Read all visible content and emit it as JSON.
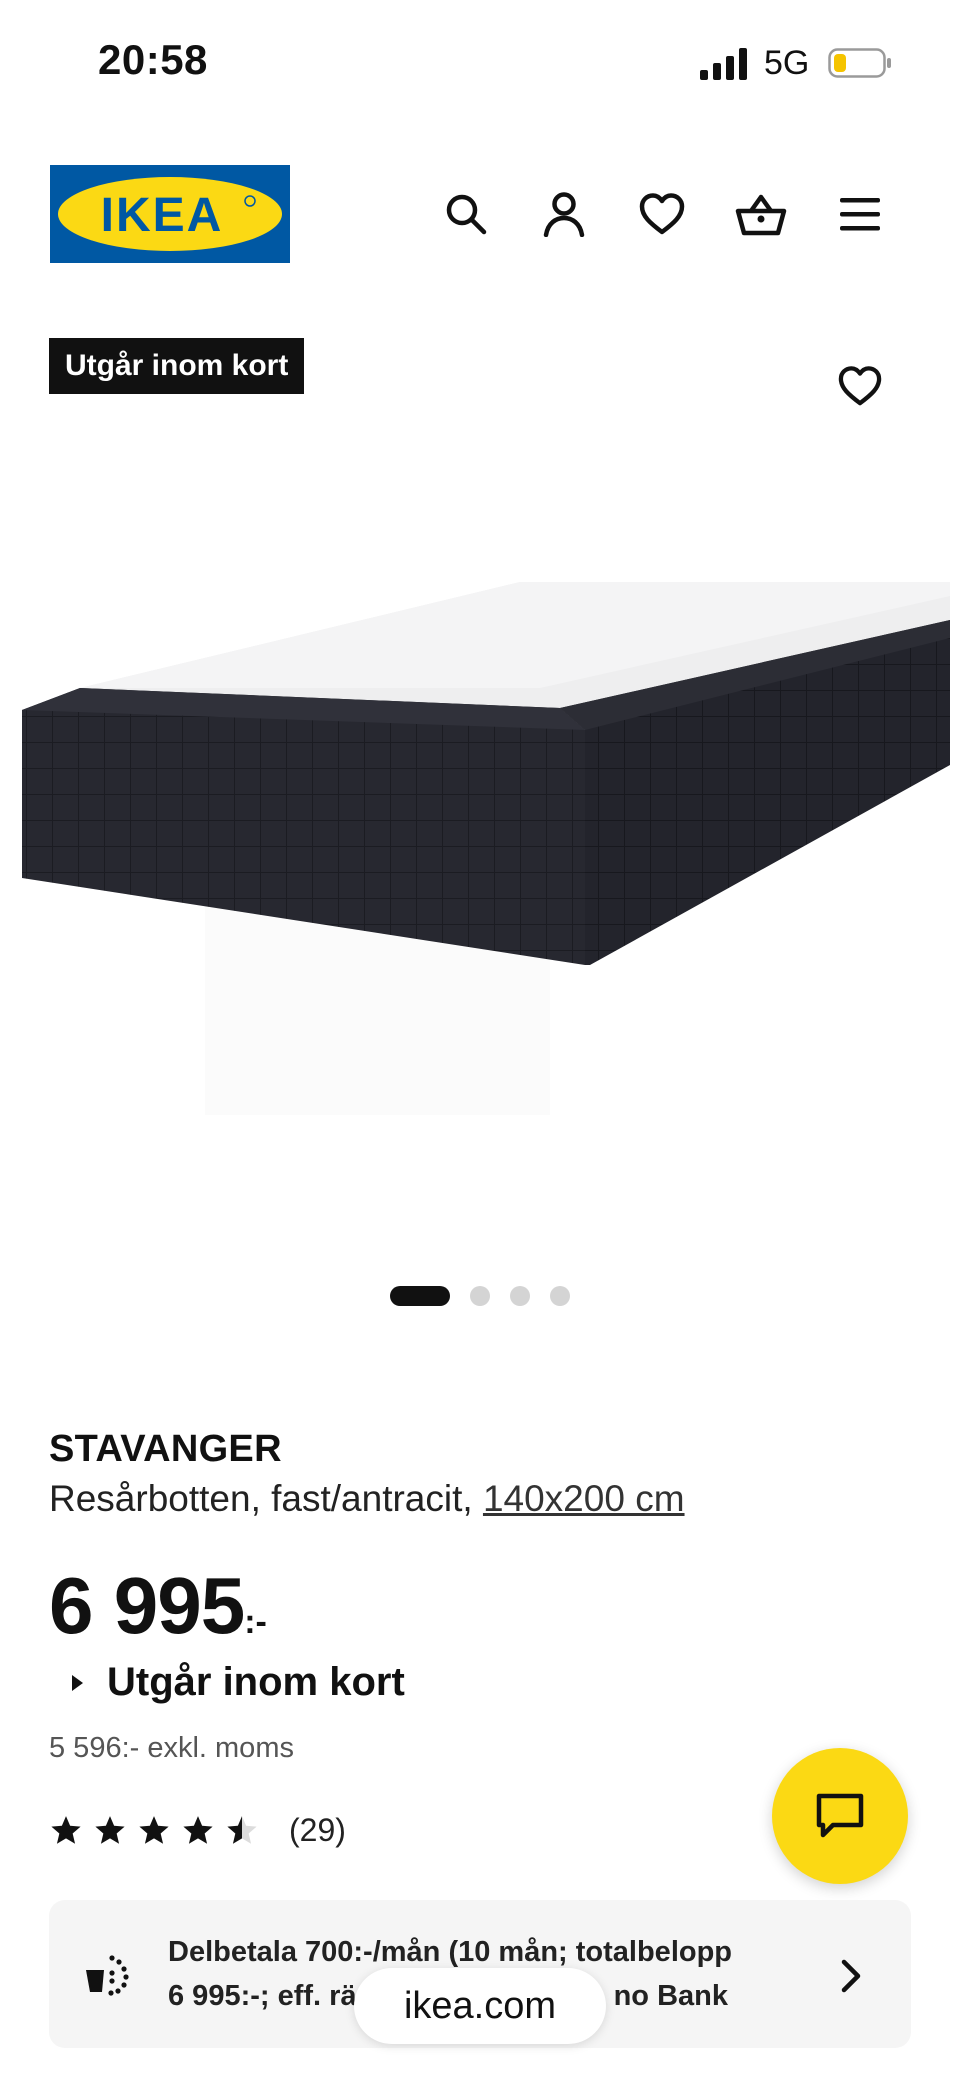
{
  "status_bar": {
    "time": "20:58",
    "network": "5G",
    "battery_color": "#f5c400"
  },
  "header": {
    "logo_text": "IKEA",
    "brand_blue": "#0058a3",
    "brand_yellow": "#fbd914",
    "icons": [
      "search-icon",
      "account-icon",
      "heart-icon",
      "basket-icon",
      "menu-icon"
    ]
  },
  "product": {
    "badge": "Utgår inom kort",
    "name": "STAVANGER",
    "description": "Resårbotten, fast/antracit,",
    "size": "140x200 cm",
    "price": "6 995",
    "currency": ":-",
    "availability": "Utgår inom kort",
    "price_ex_vat": "5 596:- exkl. moms",
    "rating": 4.5,
    "review_count": "(29)",
    "image_count": 4,
    "active_image": 1
  },
  "payment": {
    "line1": "Delbetala 700:-/mån (10 mån; totalbelopp",
    "line2_left": "6 995:-; eff. rä",
    "line2_right": "no Bank"
  },
  "browser": {
    "url": "ikea.com"
  }
}
